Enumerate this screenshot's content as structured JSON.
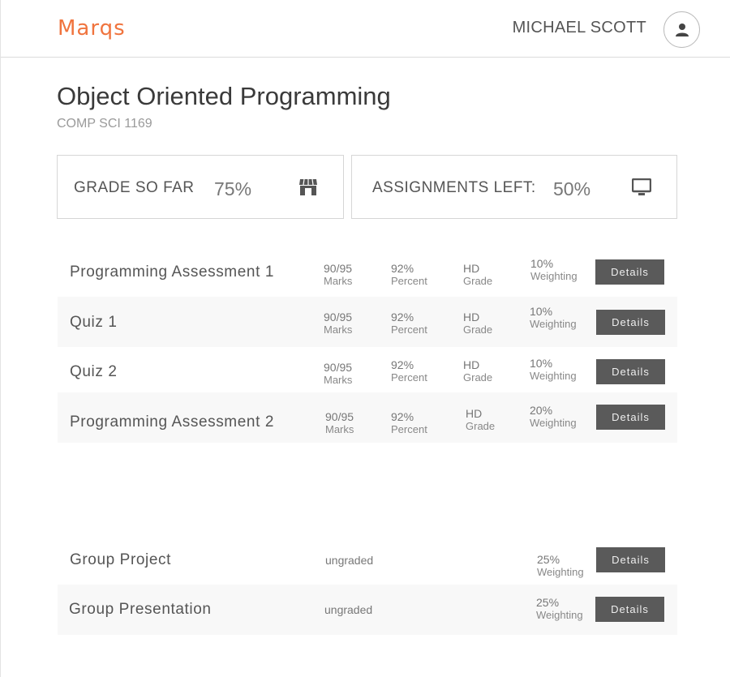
{
  "header": {
    "logo": "Marqs",
    "user_name": "MICHAEL SCOTT",
    "avatar_icon": "user-icon"
  },
  "course": {
    "title": "Object Oriented Programming",
    "code": "COMP SCI 1169"
  },
  "cards": [
    {
      "label": "GRADE SO FAR",
      "value": "75%",
      "icon": "store-icon"
    },
    {
      "label": "ASSIGNMENTS LEFT:",
      "value": "50%",
      "icon": "monitor-icon"
    }
  ],
  "assessments": [
    {
      "name": "Programming Assessment 1",
      "marks": "90/95",
      "marks_label": "Marks",
      "percent": "92%",
      "percent_label": "Percent",
      "grade": "HD",
      "grade_label": "Grade",
      "weighting": "10%",
      "weighting_label": "Weighting",
      "button": "Details"
    },
    {
      "name": "Quiz 1",
      "marks": "90/95",
      "marks_label": "Marks",
      "percent": "92%",
      "percent_label": "Percent",
      "grade": "HD",
      "grade_label": "Grade",
      "weighting": "10%",
      "weighting_label": "Weighting",
      "button": "Details"
    },
    {
      "name": "Quiz 2",
      "marks": "90/95",
      "marks_label": "Marks",
      "percent": "92%",
      "percent_label": "Percent",
      "grade": "HD",
      "grade_label": "Grade",
      "weighting": "10%",
      "weighting_label": "Weighting",
      "button": "Details"
    },
    {
      "name": "Programming Assessment 2",
      "marks": "90/95",
      "marks_label": "Marks",
      "percent": "92%",
      "percent_label": "Percent",
      "grade": "HD",
      "grade_label": "Grade",
      "weighting": "20%",
      "weighting_label": "Weighting",
      "button": "Details"
    }
  ],
  "ungraded_assessments": [
    {
      "name": "Group Project",
      "status": "ungraded",
      "weighting": "25%",
      "weighting_label": "Weighting",
      "button": "Details"
    },
    {
      "name": "Group Presentation",
      "status": "ungraded",
      "weighting": "25%",
      "weighting_label": "Weighting",
      "button": "Details"
    }
  ]
}
